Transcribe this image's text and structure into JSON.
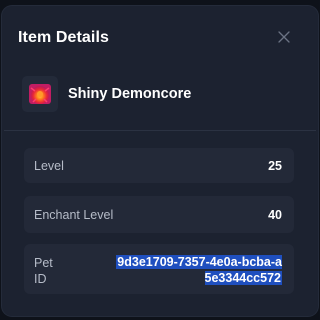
{
  "dialog": {
    "title": "Item Details",
    "close_icon": "close-icon"
  },
  "item": {
    "name": "Shiny Demoncore",
    "icon": "demoncore-item-icon"
  },
  "stats": {
    "level": {
      "label": "Level",
      "value": "25"
    },
    "enchant_level": {
      "label": "Enchant Level",
      "value": "40"
    },
    "pet_id": {
      "label": "Pet ID",
      "value": "9d3e1709-7357-4e0a-bcba-a5e3344cc572"
    }
  },
  "colors": {
    "selection": "#1f4fbf",
    "card_bg": "#232938",
    "dialog_bg": "#1c2230"
  }
}
